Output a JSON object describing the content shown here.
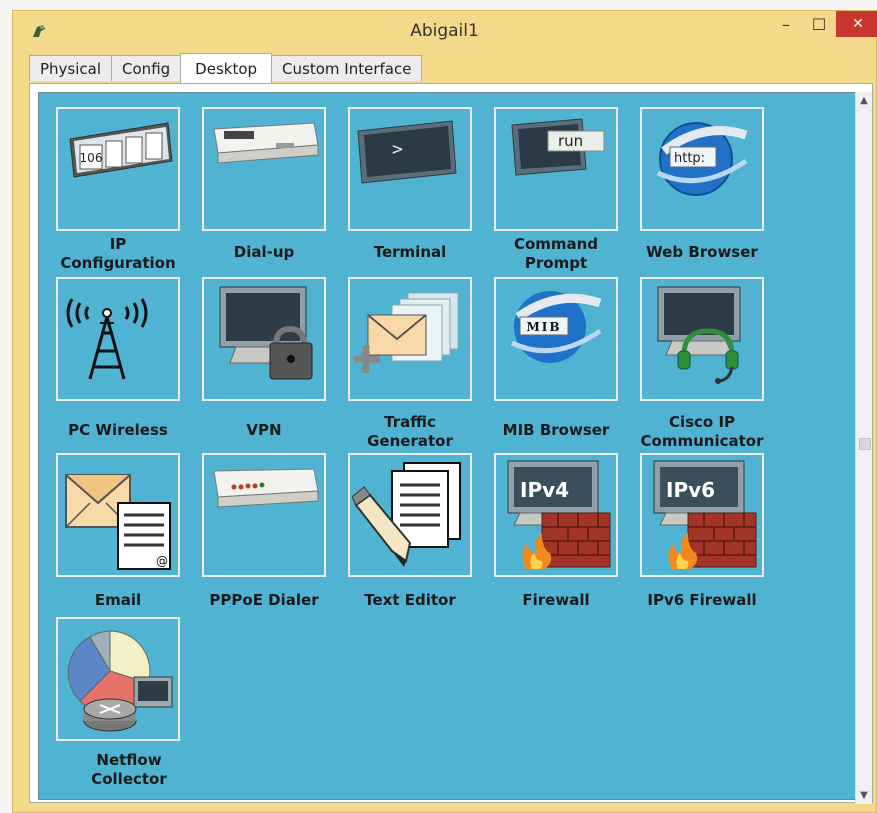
{
  "window": {
    "title": "Abigail1",
    "minimize_label": "–",
    "maximize_label": "☐",
    "close_label": "✕"
  },
  "tabs": [
    {
      "label": "Physical"
    },
    {
      "label": "Config"
    },
    {
      "label": "Desktop"
    },
    {
      "label": "Custom Interface"
    }
  ],
  "desktop": {
    "apps": [
      {
        "label": "IP\nConfiguration",
        "icon": "ip-config-icon"
      },
      {
        "label": "Dial-up",
        "icon": "modem-icon"
      },
      {
        "label": "Terminal",
        "icon": "terminal-icon"
      },
      {
        "label": "Command\nPrompt",
        "icon": "command-prompt-icon"
      },
      {
        "label": "Web Browser",
        "icon": "browser-globe-icon"
      },
      {
        "label": "PC Wireless",
        "icon": "wireless-tower-icon"
      },
      {
        "label": "VPN",
        "icon": "monitor-lock-icon"
      },
      {
        "label": "Traffic\nGenerator",
        "icon": "envelope-plus-icon"
      },
      {
        "label": "MIB Browser",
        "icon": "mib-globe-icon"
      },
      {
        "label": "Cisco IP\nCommunicator",
        "icon": "headset-monitor-icon"
      },
      {
        "label": "Email",
        "icon": "email-icon"
      },
      {
        "label": "PPPoE Dialer",
        "icon": "modem-leds-icon"
      },
      {
        "label": "Text Editor",
        "icon": "pencil-document-icon"
      },
      {
        "label": "Firewall",
        "icon": "ipv4-firewall-icon"
      },
      {
        "label": "IPv6 Firewall",
        "icon": "ipv6-firewall-icon"
      },
      {
        "label": "Netflow\nCollector",
        "icon": "netflow-pie-icon"
      }
    ],
    "icon_text": {
      "ip_config": "106",
      "terminal_prompt": ">",
      "command_run": "run",
      "browser_http": "http:",
      "mib": "MIB",
      "ipv4": "IPv4",
      "ipv6": "IPv6"
    }
  }
}
